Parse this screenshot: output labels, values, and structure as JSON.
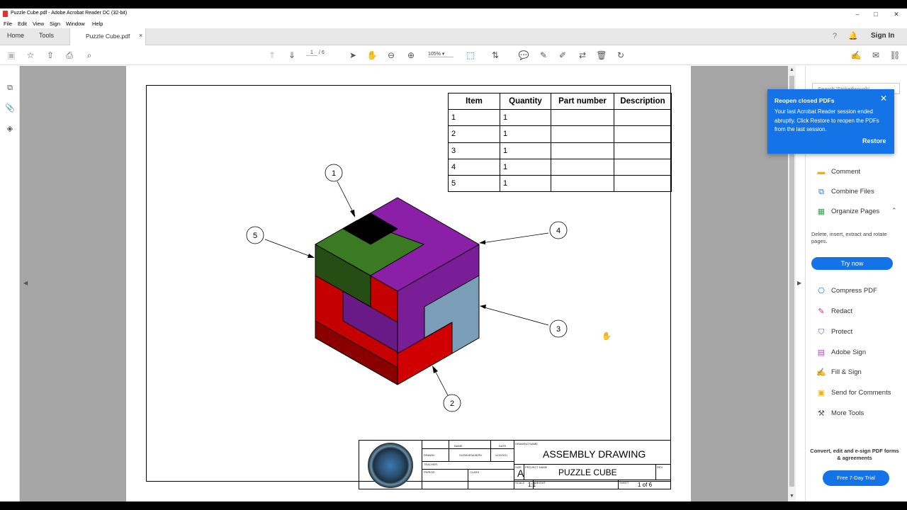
{
  "window": {
    "title": "Puzzle Cube.pdf - Adobe Acrobat Reader DC (32-bit)",
    "controls": [
      "–",
      "□",
      "✕"
    ]
  },
  "menu": [
    "File",
    "Edit",
    "View",
    "Sign",
    "Window",
    "Help"
  ],
  "tabs": {
    "home": "Home",
    "tools": "Tools",
    "document": "Puzzle Cube.pdf",
    "close": "×",
    "sign_in": "Sign In"
  },
  "toolbar": {
    "page_current": "1",
    "page_total": "/ 6",
    "zoom": "105%"
  },
  "bom": {
    "headers": [
      "Item",
      "Quantity",
      "Part number",
      "Description"
    ],
    "rows": [
      [
        "1",
        "1",
        "",
        ""
      ],
      [
        "2",
        "1",
        "",
        ""
      ],
      [
        "3",
        "1",
        "",
        ""
      ],
      [
        "4",
        "1",
        "",
        ""
      ],
      [
        "5",
        "1",
        "",
        ""
      ]
    ]
  },
  "balloons": [
    "1",
    "2",
    "3",
    "4",
    "5"
  ],
  "title_block": {
    "name_hdr": "NAME",
    "date_hdr": "DATE",
    "drawn": "DRAWN",
    "drawn_name": "GLENN BRADBURY",
    "drawn_date": "11/15/2021",
    "teacher": "TEACHER",
    "period": "PERIOD",
    "class": "CLASS",
    "drawing_name_hdr": "DRAWING NAME",
    "drawing_name": "ASSEMBLY DRAWING",
    "size_hdr": "SIZE",
    "size": "A",
    "project_hdr": "PROJECT NAME",
    "project": "PUZZLE CUBE",
    "rev_hdr": "REV",
    "scale_hdr": "SCALE",
    "scale": "1:1",
    "weight_hdr": "WEIGHT",
    "sheet_hdr": "SHEET",
    "sheet": "1 of 6",
    "logo_text": "GALLATIN HIGH SCHOOL ENGINEERING"
  },
  "right_pane": {
    "search_placeholder": "Search 'Strikethrough'",
    "tools": [
      {
        "label": "Comment",
        "icon": "comment-icon",
        "color": "#f0b400"
      },
      {
        "label": "Combine Files",
        "icon": "combine-icon",
        "color": "#1473e6"
      },
      {
        "label": "Organize Pages",
        "icon": "organize-icon",
        "color": "#2da44e"
      }
    ],
    "organize_desc": "Delete, insert, extract and rotate pages.",
    "try_now": "Try now",
    "more_tools": [
      {
        "label": "Compress PDF",
        "icon": "compress-icon",
        "color": "#1473e6"
      },
      {
        "label": "Redact",
        "icon": "redact-icon",
        "color": "#e0245e"
      },
      {
        "label": "Protect",
        "icon": "protect-icon",
        "color": "#5b5fc7"
      },
      {
        "label": "Adobe Sign",
        "icon": "sign-icon",
        "color": "#b240c2"
      },
      {
        "label": "Fill & Sign",
        "icon": "fill-sign-icon",
        "color": "#7b4fd6"
      },
      {
        "label": "Send for Comments",
        "icon": "send-comments-icon",
        "color": "#f0b400"
      },
      {
        "label": "More Tools",
        "icon": "more-tools-icon",
        "color": "#555555"
      }
    ],
    "promo": "Convert, edit and e-sign PDF forms & agreements",
    "trial": "Free 7-Day Trial"
  },
  "notification": {
    "title": "Reopen closed PDFs",
    "body": "Your last Acrobat Reader session ended abruptly. Click Restore to reopen the PDFs from the last session.",
    "close": "✕",
    "action": "Restore"
  },
  "colors": {
    "accent": "#1473e6",
    "purple": "#8b1fa8",
    "green": "#3a7a22",
    "dark_green": "#254d14",
    "red": "#c80000",
    "dark_red": "#8a0000",
    "blue_gray": "#7a9db8"
  }
}
